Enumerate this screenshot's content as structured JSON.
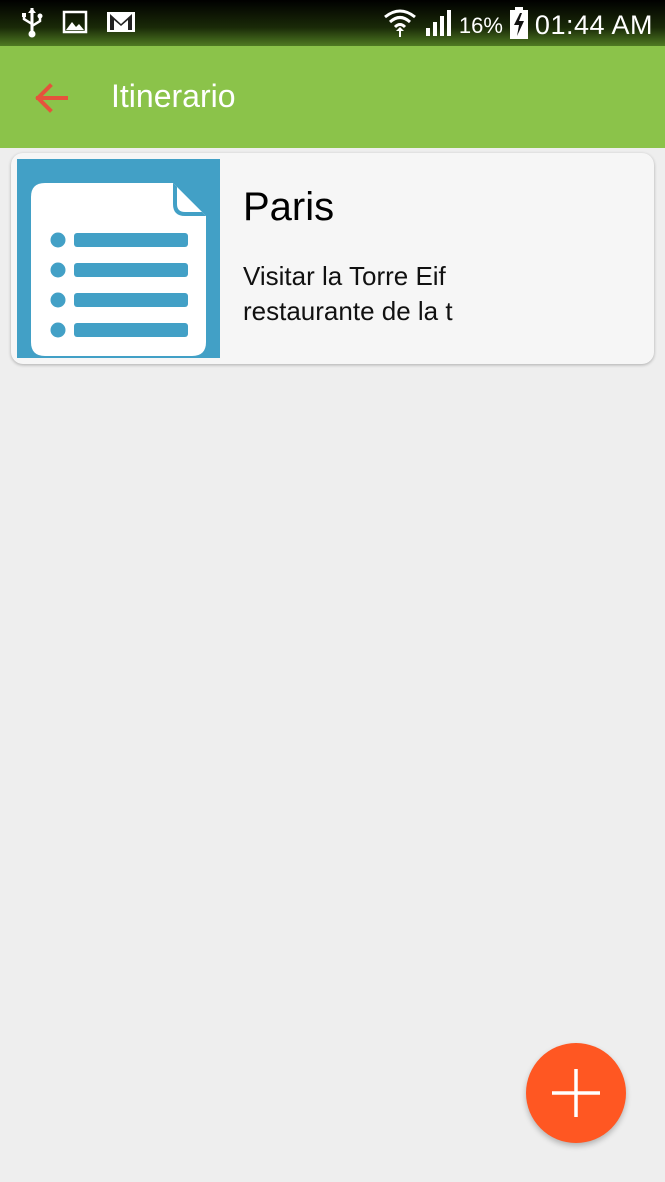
{
  "status_bar": {
    "battery": "16%",
    "time": "01:44 AM",
    "icons": [
      "usb-icon",
      "gallery-icon",
      "gmail-icon",
      "wifi-icon",
      "signal-icon",
      "battery-charging-icon"
    ]
  },
  "app_bar": {
    "title": "Itinerario",
    "back_icon": "arrow-left-icon",
    "back_icon_color": "#e5533c"
  },
  "itineraries": [
    {
      "title": "Paris",
      "description_line1": "Visitar la Torre Eif",
      "description_line2": "restaurante de la t",
      "thumbnail_icon": "list-document-icon"
    }
  ],
  "fab": {
    "icon": "plus-icon",
    "color": "#ff5722"
  },
  "colors": {
    "app_bar": "#8bc34a",
    "background": "#eeeeee",
    "card": "#f6f6f6",
    "thumbnail": "#42a0c6"
  }
}
